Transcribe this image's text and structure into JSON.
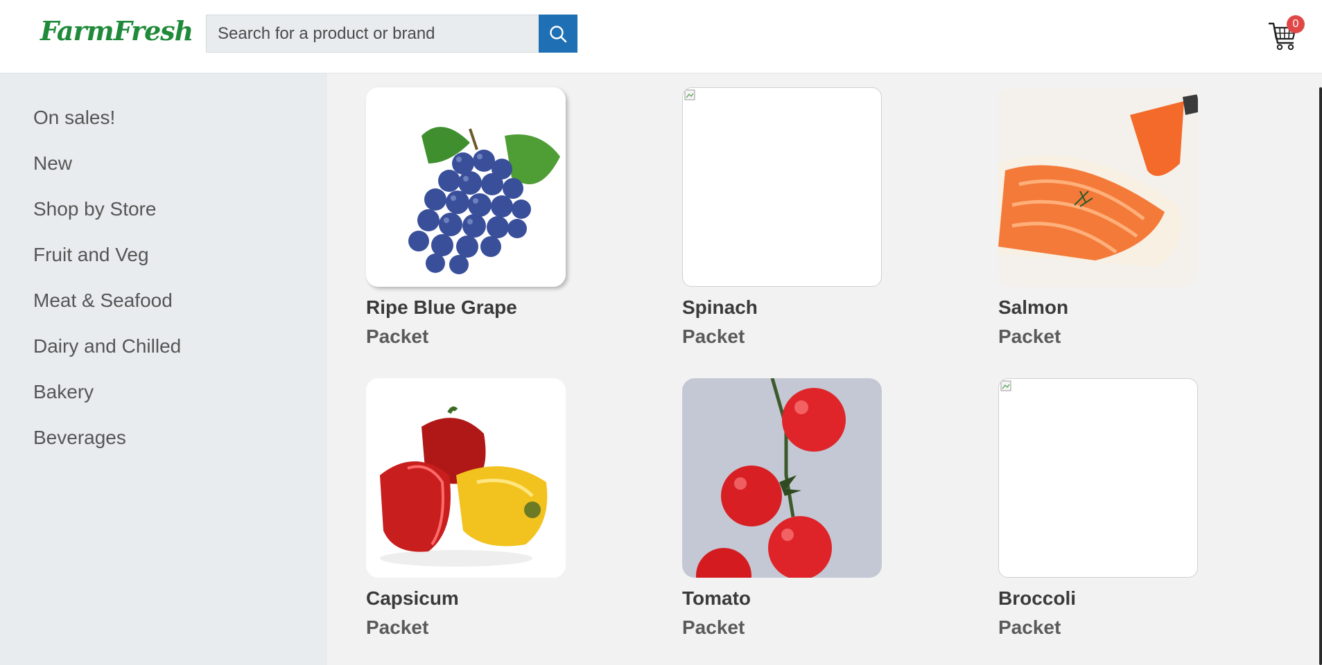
{
  "header": {
    "logo_text": "FarmFresh",
    "search": {
      "placeholder": "Search for a product or brand",
      "value": ""
    },
    "cart": {
      "count": "0"
    }
  },
  "sidebar": {
    "items": [
      {
        "label": "On sales!"
      },
      {
        "label": "New"
      },
      {
        "label": "Shop by Store"
      },
      {
        "label": "Fruit and Veg"
      },
      {
        "label": "Meat & Seafood"
      },
      {
        "label": "Dairy and Chilled"
      },
      {
        "label": "Bakery"
      },
      {
        "label": "Beverages"
      }
    ]
  },
  "products": [
    {
      "name": "Ripe Blue Grape",
      "unit": "Packet",
      "image": "grapes"
    },
    {
      "name": "Spinach",
      "unit": "Packet",
      "image": "broken"
    },
    {
      "name": "Salmon",
      "unit": "Packet",
      "image": "salmon"
    },
    {
      "name": "Capsicum",
      "unit": "Packet",
      "image": "capsicum"
    },
    {
      "name": "Tomato",
      "unit": "Packet",
      "image": "tomato"
    },
    {
      "name": "Broccoli",
      "unit": "Packet",
      "image": "broken"
    }
  ],
  "colors": {
    "accent": "#1f6fb4",
    "brand": "#1f8a3a",
    "badge": "#e04848"
  }
}
